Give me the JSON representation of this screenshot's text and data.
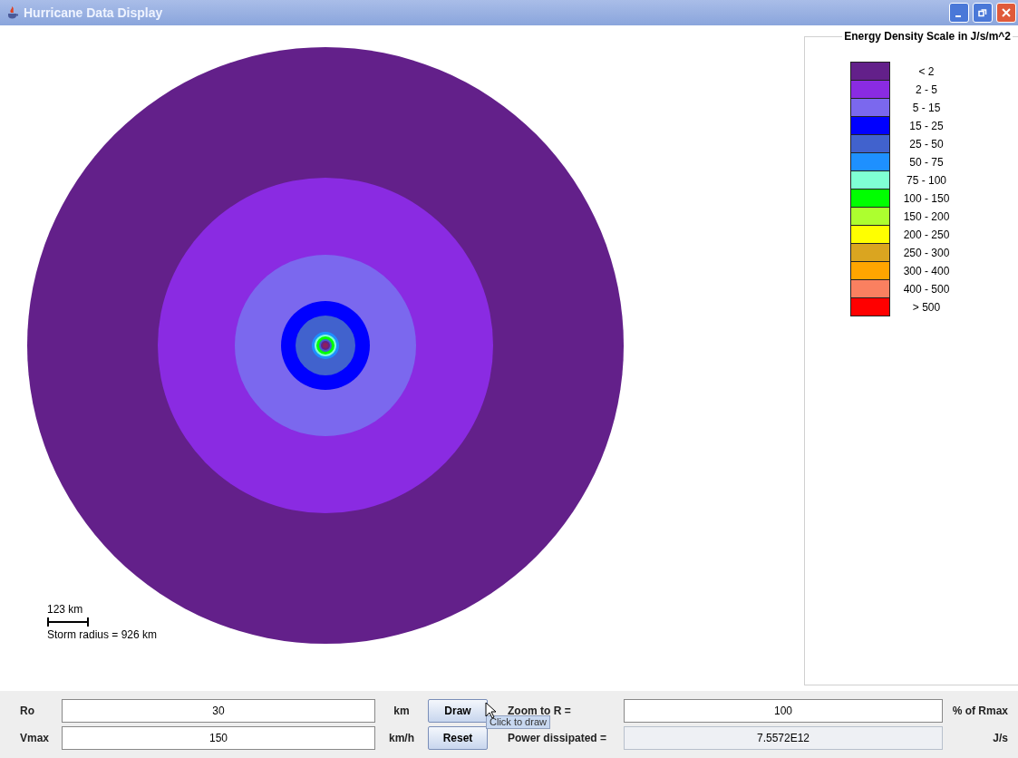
{
  "window": {
    "title": "Hurricane Data Display"
  },
  "plot": {
    "scale_label": "123 km",
    "storm_radius": "Storm radius = 926 km"
  },
  "legend": {
    "title": "Energy Density Scale in J/s/m^2",
    "items": [
      {
        "label": "< 2",
        "color": "#63208a"
      },
      {
        "label": "2 - 5",
        "color": "#8a2be2"
      },
      {
        "label": "5 - 15",
        "color": "#7b68ee"
      },
      {
        "label": "15 - 25",
        "color": "#0000ff"
      },
      {
        "label": "25 - 50",
        "color": "#4162cd"
      },
      {
        "label": "50 - 75",
        "color": "#1e90ff"
      },
      {
        "label": "75 - 100",
        "color": "#7fffd4"
      },
      {
        "label": "100 - 150",
        "color": "#00ff00"
      },
      {
        "label": "150 - 200",
        "color": "#adff2f"
      },
      {
        "label": "200 - 250",
        "color": "#ffff00"
      },
      {
        "label": "250 - 300",
        "color": "#daa520"
      },
      {
        "label": "300 - 400",
        "color": "#ffa500"
      },
      {
        "label": "400 - 500",
        "color": "#fa8060"
      },
      {
        "label": "> 500",
        "color": "#ff0000"
      }
    ]
  },
  "controls": {
    "ro_label": "Ro",
    "ro_value": "30",
    "ro_unit": "km",
    "draw_button": "Draw",
    "zoom_label": "Zoom to R =",
    "zoom_value": "100",
    "zoom_unit": "% of Rmax",
    "vmax_label": "Vmax",
    "vmax_value": "150",
    "vmax_unit": "km/h",
    "reset_button": "Reset",
    "power_label": "Power dissipated =",
    "power_value": "7.5572E12",
    "power_unit": "J/s",
    "power_disabled": true
  },
  "tooltip": "Click to draw"
}
